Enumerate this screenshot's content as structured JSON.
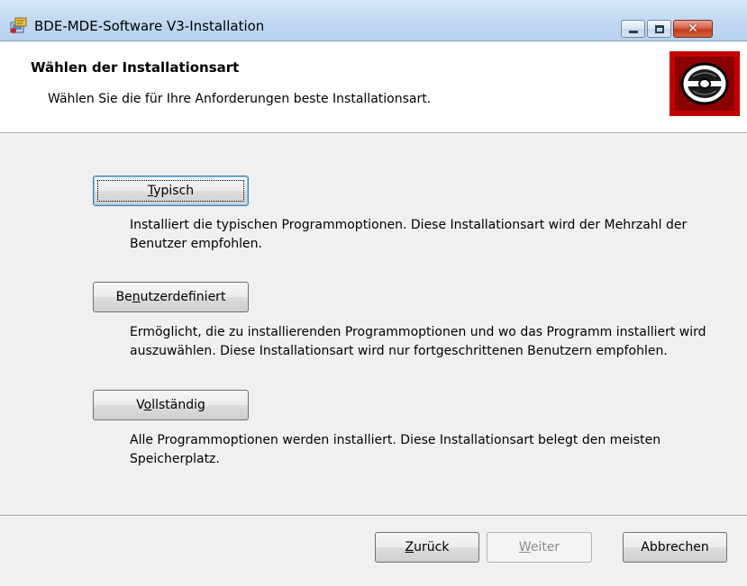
{
  "window": {
    "title": "BDE-MDE-Software V3-Installation",
    "icon": "installer-icon"
  },
  "banner": {
    "title": "Wählen der Installationsart",
    "subtitle": "Wählen Sie die für Ihre Anforderungen beste Installationsart.",
    "logo_icon": "cd-disc-icon"
  },
  "options": {
    "typical": {
      "label_pre": "",
      "label_mnemonic": "T",
      "label_post": "ypisch",
      "description": "Installiert die typischen Programmoptionen. Diese Installationsart wird der Mehrzahl der Benutzer empfohlen."
    },
    "custom": {
      "label_pre": "Be",
      "label_mnemonic": "n",
      "label_post": "utzerdefiniert",
      "description": "Ermöglicht, die zu installierenden Programmoptionen und wo das Programm installiert wird auszuwählen. Diese Installationsart wird nur fortgeschrittenen Benutzern empfohlen."
    },
    "complete": {
      "label_pre": "V",
      "label_mnemonic": "o",
      "label_post": "llständig",
      "description": "Alle Programmoptionen werden installiert. Diese Installationsart belegt den meisten Speicherplatz."
    }
  },
  "footer": {
    "back": {
      "label_pre": "",
      "label_mnemonic": "Z",
      "label_post": "urück"
    },
    "next": {
      "label_pre": "",
      "label_mnemonic": "W",
      "label_post": "eiter"
    },
    "cancel": {
      "label": "Abbrechen"
    }
  },
  "colors": {
    "logo_red": "#c20000",
    "titlebar": "#c3daf2",
    "close_button": "#c3391f"
  }
}
